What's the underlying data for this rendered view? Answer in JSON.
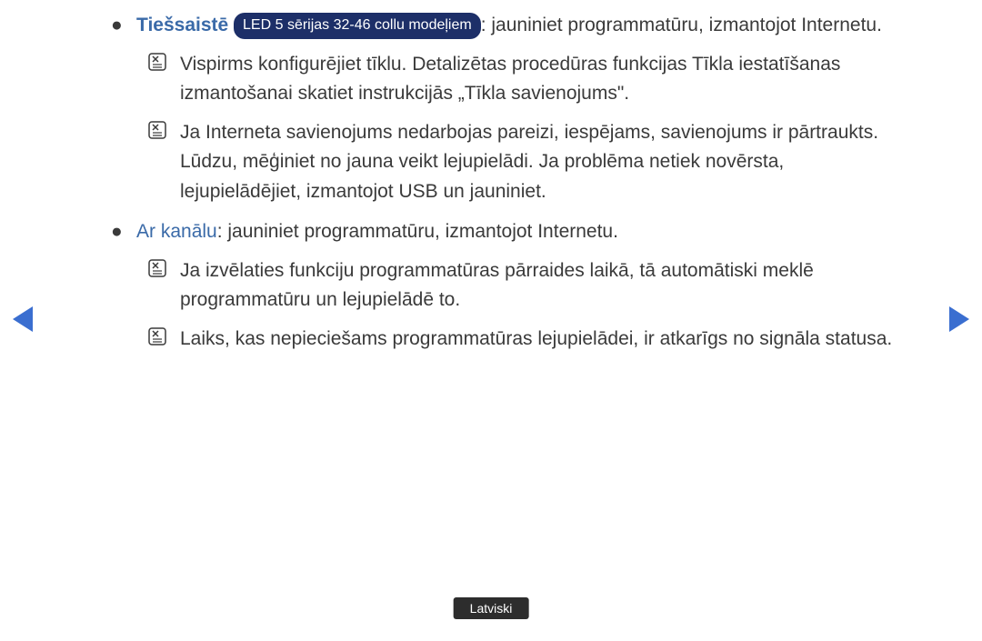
{
  "content": {
    "item1": {
      "label": "Tiešsaistē",
      "pill": "LED 5 sērijas 32-46 collu modeļiem",
      "text_after": ": jauniniet programmatūru, izmantojot Internetu.",
      "notes": [
        "Vispirms konfigurējiet tīklu. Detalizētas procedūras funkcijas Tīkla iestatīšanas izmantošanai skatiet instrukcijās „Tīkla savienojums\".",
        "Ja Interneta savienojums nedarbojas pareizi, iespējams, savienojums ir pārtraukts. Lūdzu, mēģiniet no jauna veikt lejupielādi. Ja problēma netiek novērsta, lejupielādējiet, izmantojot USB un jauniniet."
      ]
    },
    "item2": {
      "label": "Ar kanālu",
      "text_after": ": jauniniet programmatūru, izmantojot Internetu.",
      "notes": [
        "Ja izvēlaties funkciju programmatūras pārraides laikā, tā automātiski meklē programmatūru un lejupielādē to.",
        "Laiks, kas nepieciešams programmatūras lejupielādei, ir atkarīgs no signāla statusa."
      ]
    }
  },
  "language": "Latviski",
  "icons": {
    "note": "note-icon",
    "bullet": "●"
  },
  "colors": {
    "accent": "#3a6aa8",
    "pill_bg": "#1d2f68",
    "arrow": "#3a6ed0",
    "text": "#3a3a3a",
    "badge_bg": "#2d2d2d"
  }
}
